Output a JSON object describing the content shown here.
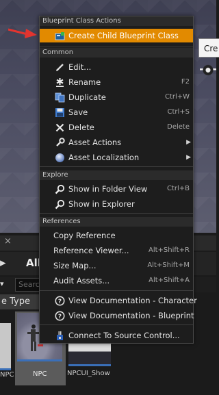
{
  "background": {
    "viewport_tooltip": "Cre",
    "tab_close": "×",
    "path_arrow": "▸",
    "path_text": "All",
    "filter_dropdown": "▾",
    "search_placeholder": "Searc",
    "type_pill": "e Type",
    "assets": [
      {
        "name": "NPC"
      },
      {
        "name": "NPC"
      },
      {
        "name": "NPCUI_Show"
      }
    ]
  },
  "menu": {
    "sections": {
      "blueprint": "Blueprint Class Actions",
      "common": "Common",
      "explore": "Explore",
      "references": "References"
    },
    "blueprint_items": [
      {
        "label": "Create Child Blueprint Class",
        "icon": "blueprint-icon"
      }
    ],
    "common_items": [
      {
        "label": "Edit...",
        "icon": "edit-pencil-icon"
      },
      {
        "label": "Rename",
        "shortcut": "F2",
        "icon": "rename-asterisk-icon"
      },
      {
        "label": "Duplicate",
        "shortcut": "Ctrl+W",
        "icon": "duplicate-icon"
      },
      {
        "label": "Save",
        "shortcut": "Ctrl+S",
        "icon": "save-floppy-icon"
      },
      {
        "label": "Delete",
        "shortcut": "Delete",
        "icon": "delete-x-icon"
      },
      {
        "label": "Asset Actions",
        "submenu": "▶",
        "icon": "wrench-icon"
      },
      {
        "label": "Asset Localization",
        "submenu": "▶",
        "icon": "globe-icon"
      }
    ],
    "explore_items": [
      {
        "label": "Show in Folder View",
        "shortcut": "Ctrl+B",
        "icon": "magnifier-icon"
      },
      {
        "label": "Show in Explorer",
        "icon": "magnifier-icon"
      }
    ],
    "reference_items": [
      {
        "label": "Copy Reference"
      },
      {
        "label": "Reference Viewer...",
        "shortcut": "Alt+Shift+R"
      },
      {
        "label": "Size Map...",
        "shortcut": "Alt+Shift+M"
      },
      {
        "label": "Audit Assets...",
        "shortcut": "Alt+Shift+A"
      }
    ],
    "doc_items": [
      {
        "label": "View Documentation - Character",
        "icon": "help-circle-icon"
      },
      {
        "label": "View Documentation - Blueprint",
        "icon": "help-circle-icon"
      }
    ],
    "source_items": [
      {
        "label": "Connect To Source Control...",
        "icon": "source-control-icon"
      }
    ]
  },
  "colors": {
    "highlight": "#e28a00",
    "arrow": "#e3342f",
    "selection_bar": "#3a6fb8"
  }
}
